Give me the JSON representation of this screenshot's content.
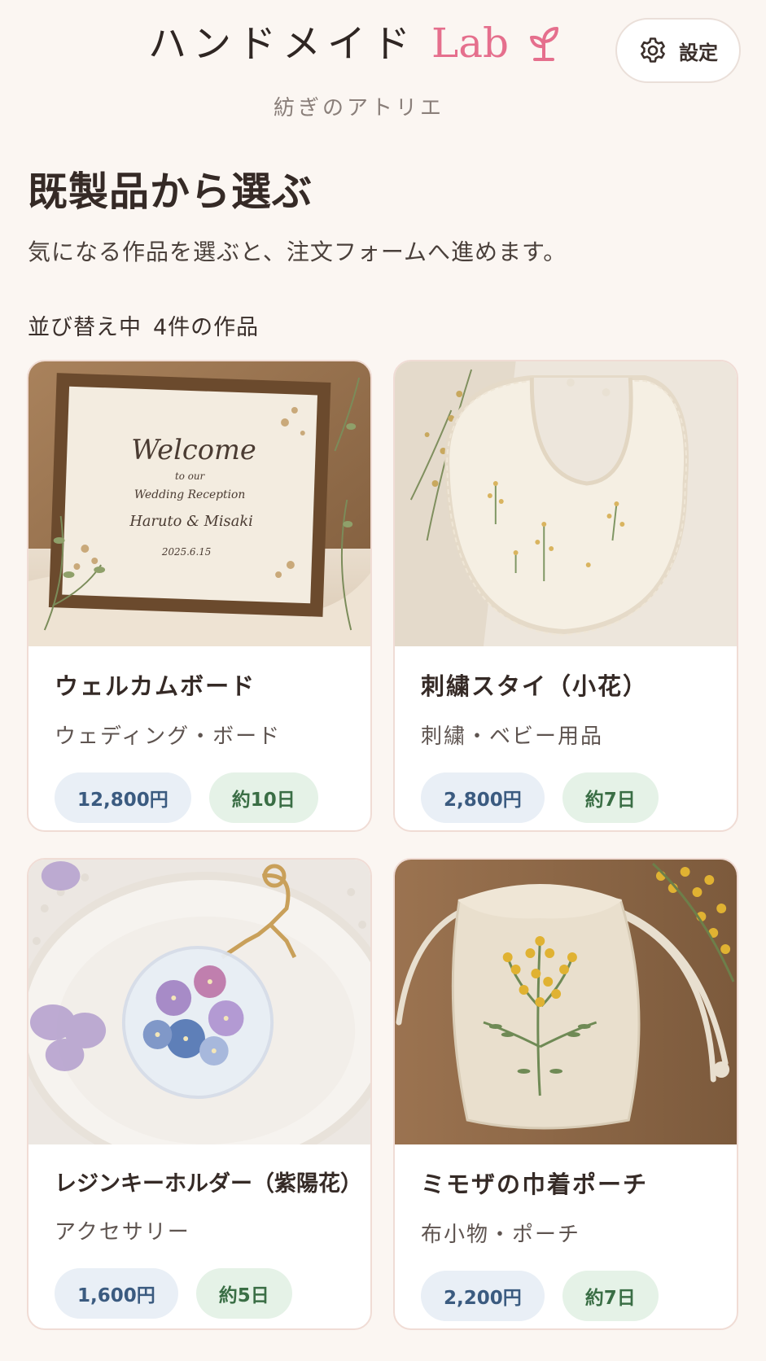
{
  "header": {
    "brand_jp": "ハンドメイド",
    "brand_lab": "Lab",
    "subtitle": "紡ぎのアトリエ",
    "settings_label": "設定"
  },
  "section": {
    "title": "既製品から選ぶ",
    "description": "気になる作品を選ぶと、注文フォームへ進めます。",
    "sort_label": "並び替え中",
    "count_label": "4件の作品"
  },
  "products": [
    {
      "title": "ウェルカムボード",
      "category": "ウェディング・ボード",
      "price": "12,800円",
      "lead_time": "約10日",
      "image_text": {
        "line1": "Welcome",
        "line2": "to our",
        "line3": "Wedding Reception",
        "line4": "Haruto & Misaki",
        "line5": "2025.6.15"
      }
    },
    {
      "title": "刺繍スタイ（小花）",
      "category": "刺繍・ベビー用品",
      "price": "2,800円",
      "lead_time": "約7日"
    },
    {
      "title": "レジンキーホルダー（紫陽花）",
      "category": "アクセサリー",
      "price": "1,600円",
      "lead_time": "約5日"
    },
    {
      "title": "ミモザの巾着ポーチ",
      "category": "布小物・ポーチ",
      "price": "2,200円",
      "lead_time": "約7日"
    }
  ],
  "colors": {
    "background": "#fbf6f2",
    "accent_pink": "#e56f8d",
    "price_tag_bg": "#e9eff6",
    "price_tag_text": "#3b5b80",
    "days_tag_bg": "#e5f2e7",
    "days_tag_text": "#3a6e45"
  },
  "icons": {
    "settings": "gear-icon",
    "brand": "sprout-icon"
  }
}
